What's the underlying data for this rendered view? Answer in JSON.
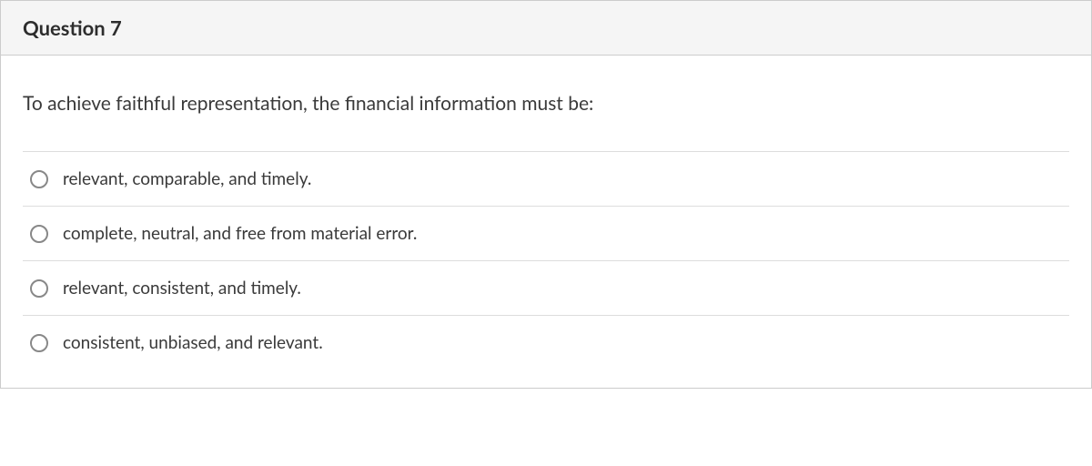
{
  "question": {
    "title": "Question 7",
    "prompt": "To achieve faithful representation, the financial information must be:",
    "options": [
      {
        "label": "relevant, comparable, and timely."
      },
      {
        "label": "complete, neutral, and free from material error."
      },
      {
        "label": "relevant, consistent, and timely."
      },
      {
        "label": "consistent, unbiased, and relevant."
      }
    ]
  }
}
